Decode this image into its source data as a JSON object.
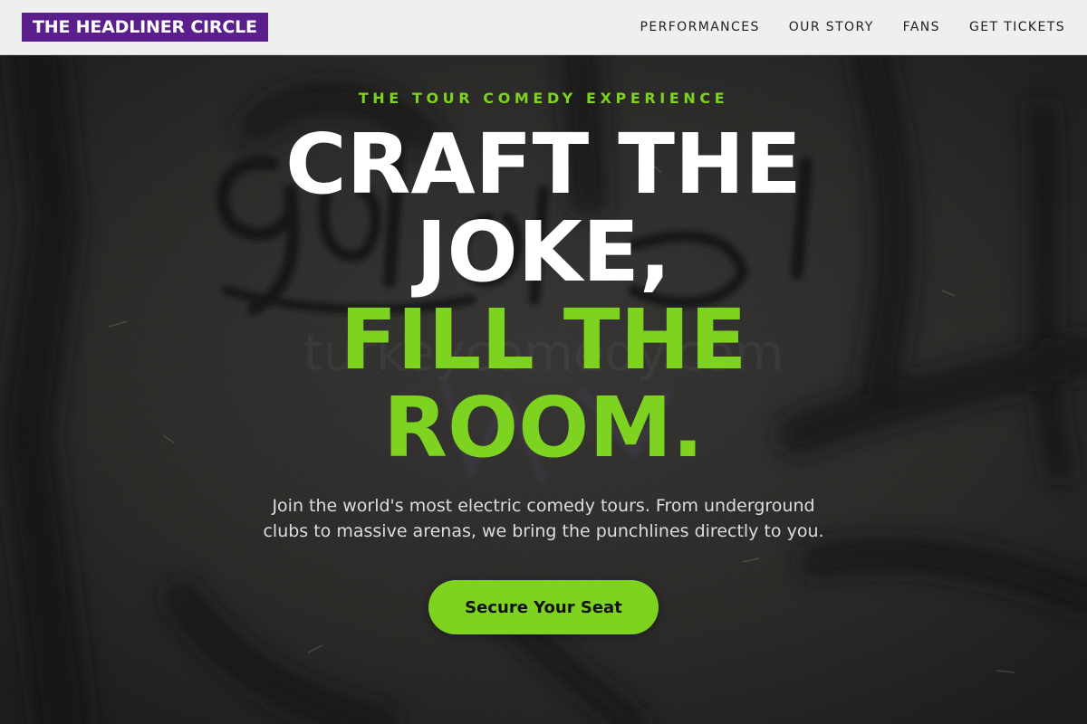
{
  "brand": {
    "name": "THE HEADLINER CIRCLE"
  },
  "nav": {
    "links": [
      "PERFORMANCES",
      "OUR STORY",
      "FANS",
      "GET TICKETS"
    ]
  },
  "hero": {
    "eyebrow": "THE TOUR COMEDY EXPERIENCE",
    "headline_white": [
      "CRAFT THE",
      "JOKE,"
    ],
    "headline_green": [
      "FILL THE",
      "ROOM."
    ],
    "subtext_line1": "Join the world's most electric comedy tours. From underground",
    "subtext_line2": "clubs to massive arenas, we bring the punchlines directly to you.",
    "cta_label": "Secure Your Seat",
    "background_image": "graffiti-wall-photo",
    "watermark": "turkeycomedy.com"
  },
  "colors": {
    "brand_purple": "#5a1f8c",
    "accent_green": "#7ed321",
    "nav_background": "#efefef",
    "headline_white": "#ffffff"
  }
}
